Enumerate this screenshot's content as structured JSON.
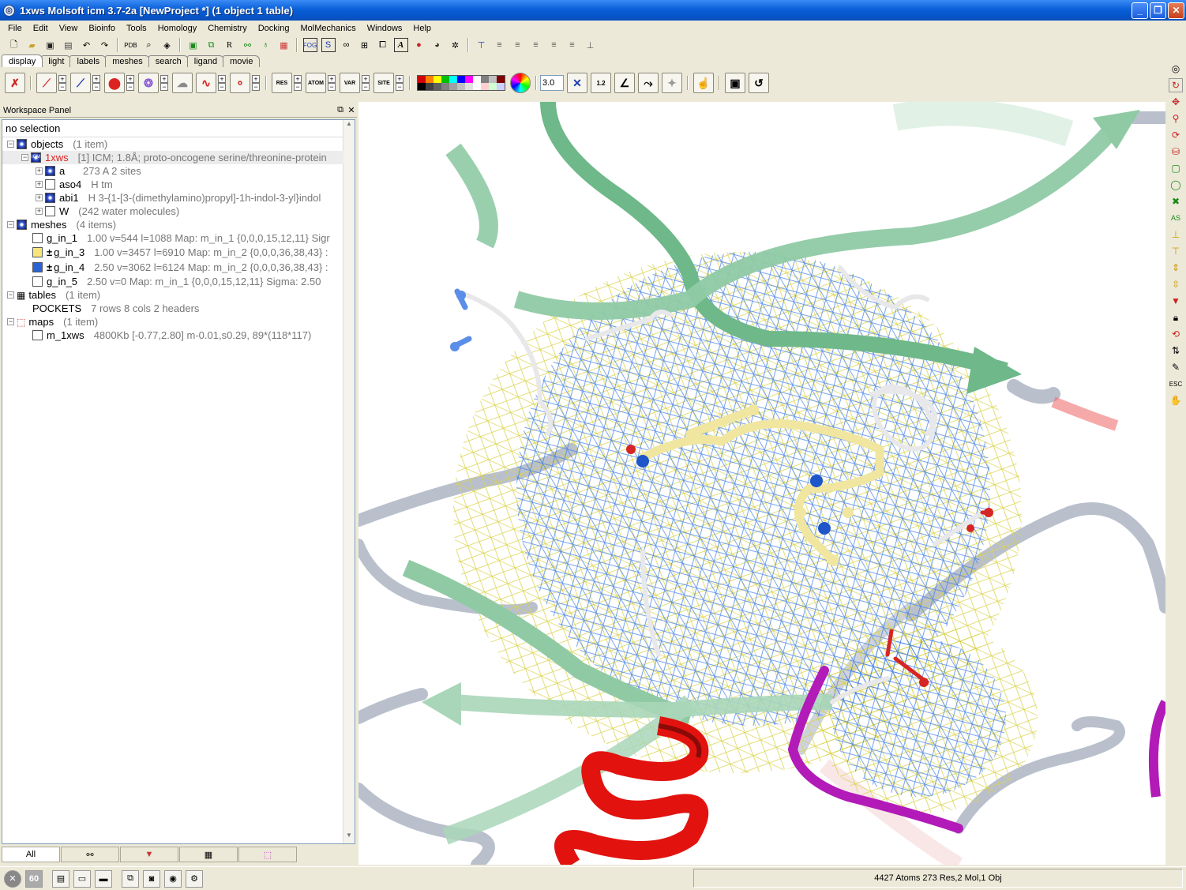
{
  "window": {
    "title": "1xws Molsoft icm 3.7-2a  [NewProject *] (1 object 1 table)",
    "min_label": "_",
    "max_label": "❐",
    "close_label": "✕"
  },
  "menu": [
    "File",
    "Edit",
    "View",
    "Bioinfo",
    "Tools",
    "Homology",
    "Chemistry",
    "Docking",
    "MolMechanics",
    "Windows",
    "Help"
  ],
  "tabs": [
    "display",
    "light",
    "labels",
    "meshes",
    "search",
    "ligand",
    "movie"
  ],
  "toolbar2": {
    "res_label": "RES",
    "atom_label": "ATOM",
    "var_label": "VAR",
    "site_label": "SITE",
    "zoom_value": "3.0",
    "ruler_label": "1.2"
  },
  "workspace": {
    "panel_title": "Workspace Panel",
    "selection_status": "no selection",
    "objects": {
      "name": "objects",
      "count": "(1 item)"
    },
    "object_1xws": {
      "badge": "ICM",
      "name": "1xws",
      "info": "[1] ICM; 1.8Å; proto-oncogene serine/threonine-protein"
    },
    "molecules": [
      {
        "name": "a",
        "info": "273 A  2 sites"
      },
      {
        "name": "aso4",
        "info": "H   tm"
      },
      {
        "name": "abi1",
        "info": "H   3-{1-[3-(dimethylamino)propyl]-1h-indol-3-yl}indol"
      },
      {
        "name": "W",
        "info": "(242 water molecules)"
      }
    ],
    "meshes": {
      "name": "meshes",
      "count": "(4 items)"
    },
    "mesh_items": [
      {
        "name": "g_in_1",
        "info": "1.00 v=544 l=1088 Map: m_in_1 {0,0,0,15,12,11} Sigr"
      },
      {
        "name": "g_in_3",
        "info": "1.00 v=3457 l=6910 Map: m_in_2 {0,0,0,36,38,43} :"
      },
      {
        "name": "g_in_4",
        "info": "2.50 v=3062 l=6124 Map: m_in_2 {0,0,0,36,38,43} :"
      },
      {
        "name": "g_in_5",
        "info": "2.50 v=0 Map: m_in_1 {0,0,0,15,12,11} Sigma: 2.50"
      }
    ],
    "mesh_sign": "±",
    "tables": {
      "name": "tables",
      "count": "(1 item)"
    },
    "table_item": {
      "name": "POCKETS",
      "info": "7 rows 8 cols 2 headers"
    },
    "maps": {
      "name": "maps",
      "count": "(1 item)"
    },
    "map_item": {
      "name": "m_1xws",
      "info": "4800Kb [-0.77,2.80] m-0.01,s0.29, 89*(118*117)"
    },
    "bottom_tab_all": "All"
  },
  "status": {
    "counts": "4427 Atoms 273 Res,2 Mol,1 Obj",
    "badge_60": "60"
  },
  "colors": {
    "title_bar": "#0a5fd8",
    "strand_green": "#8fcaa5",
    "coil_gray": "#b9c0cc",
    "helix_red": "#e2130f",
    "coil_magenta": "#b21bb8",
    "mesh_blue": "#3f7ee8",
    "mesh_yellow": "#d9d24a",
    "ligand_yellow": "#f0e6a0"
  },
  "palette": [
    "#d0000a",
    "#ff8000",
    "#ffff00",
    "#00c000",
    "#00ffff",
    "#0000ff",
    "#ff00ff",
    "#ffffff",
    "#808080",
    "#c0c0c0",
    "#800000",
    "#000000",
    "#404040",
    "#606060",
    "#808080",
    "#a0a0a0",
    "#c0c0c0",
    "#e0e0e0",
    "#ffffff",
    "#ffd0d0",
    "#d0ffd0",
    "#d0d0ff"
  ]
}
